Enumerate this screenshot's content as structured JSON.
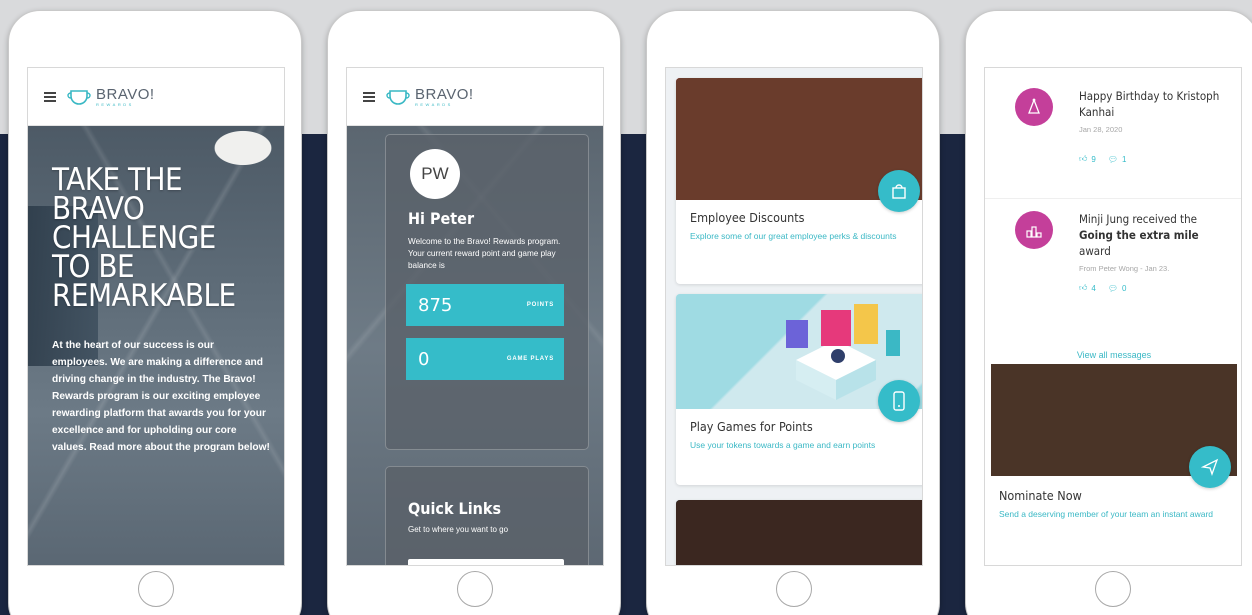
{
  "brand": {
    "name": "BRAVO!",
    "tagline": "REWARDS",
    "accent_color": "#35bcc9",
    "navy_color": "#1b2640",
    "magenta_color": "#c43f9a"
  },
  "screen1": {
    "hero_title": "TAKE THE\nBRAVO\nCHALLENGE\nTO BE\nREMARKABLE",
    "hero_body": "At the heart of our success is our employees. We are making a difference and driving change in the industry. The Bravo! Rewards program is our exciting employee rewarding platform that awards you for your excellence and for upholding our core values. Read more about the program below!"
  },
  "screen2": {
    "avatar_initials": "PW",
    "greeting": "Hi Peter",
    "welcome_text": "Welcome to the Bravo! Rewards program. Your current reward point and game play balance is",
    "stats": [
      {
        "value": "875",
        "label": "POINTS"
      },
      {
        "value": "0",
        "label": "GAME PLAYS"
      }
    ],
    "quick_links_title": "Quick Links",
    "quick_links_subtitle": "Get to where you want to go"
  },
  "screen3": {
    "cards": [
      {
        "title": "Employee Discounts",
        "description": "Explore some of our great employee perks & discounts",
        "icon": "gift-bag-icon"
      },
      {
        "title": "Play Games for Points",
        "description": "Use your tokens towards a game and earn points",
        "icon": "mobile-phone-icon"
      }
    ]
  },
  "screen4": {
    "messages": [
      {
        "title": "Happy Birthday to Kristoph Kanhai",
        "meta": "Jan 28, 2020",
        "likes": "9",
        "comments": "1",
        "icon": "party-hat-icon"
      },
      {
        "title_pre": "Minji Jung received the",
        "award": "Going the extra mile",
        "title_post": "award",
        "meta": "From Peter Wong - Jan 23.",
        "likes": "4",
        "comments": "0",
        "icon": "podium-icon"
      }
    ],
    "view_all": "View all messages",
    "nominate": {
      "title": "Nominate Now",
      "description": "Send a deserving member of your team an instant award",
      "icon": "paper-plane-icon"
    }
  }
}
